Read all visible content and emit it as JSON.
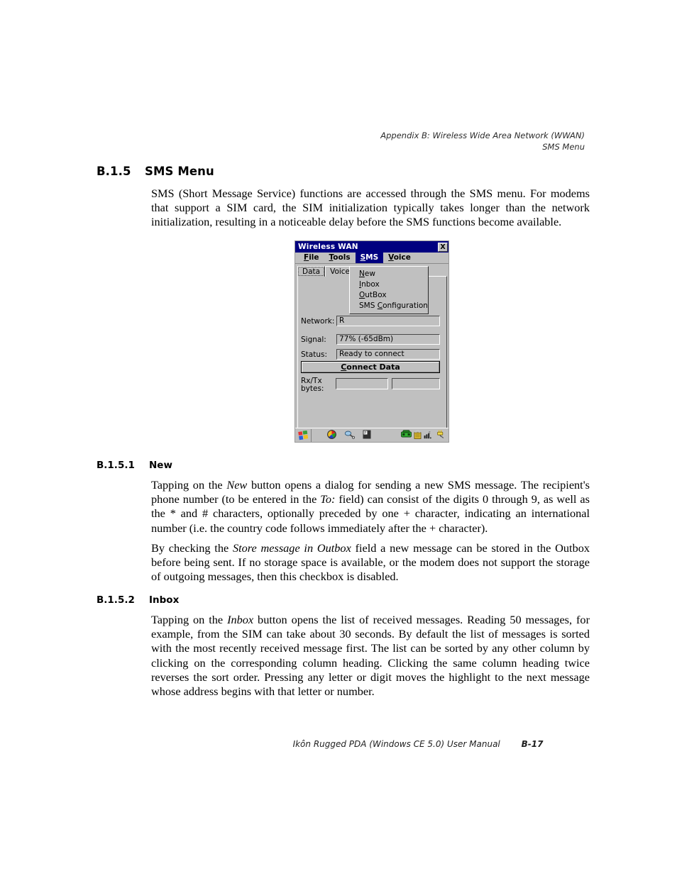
{
  "header": {
    "line1": "Appendix B: Wireless Wide Area Network (WWAN)",
    "line2": "SMS Menu"
  },
  "footer": {
    "manual": "Ikôn Rugged PDA (Windows CE 5.0) User Manual",
    "page": "B-17"
  },
  "sections": {
    "sms_menu": {
      "number": "B.1.5",
      "title": "SMS Menu",
      "body": "SMS (Short Message Service) functions are accessed through the SMS menu. For modems that support a SIM card, the SIM initialization typically takes longer than the network initialization, resulting in a noticeable delay before the SMS functions become available."
    },
    "new": {
      "number": "B.1.5.1",
      "title": "New",
      "para1_a": "Tapping on the ",
      "para1_em1": "New",
      "para1_b": " button opens a dialog for sending a new SMS message. The recipient's phone number (to be entered in the ",
      "para1_em2": "To:",
      "para1_c": " field) can consist of the digits 0 through 9, as well as the * and # characters, optionally preceded by one + character, indicating an international number (i.e. the country code follows immediately after the + character).",
      "para2_a": "By checking the ",
      "para2_em1": "Store message in Outbox",
      "para2_b": " field a new message can be stored in the Outbox before being sent. If no storage space is available, or the modem does not support the storage of outgoing messages, then this checkbox is disabled."
    },
    "inbox": {
      "number": "B.1.5.2",
      "title": "Inbox",
      "para1_a": "Tapping on the ",
      "para1_em1": "Inbox",
      "para1_b": " button opens the list of received messages. Reading 50 messages, for example, from the SIM can take about 30 seconds. By default the list of messages is sorted with the most recently received message first. The list can be sorted by any other column by clicking on the corresponding column heading. Clicking the same column heading twice reverses the sort order. Pressing any letter or digit moves the highlight to the next message whose address begins with that letter or number."
    }
  },
  "pda": {
    "window_title": "Wireless WAN",
    "close_label": "X",
    "menubar": [
      {
        "label": "File",
        "accel": "F",
        "rest": "ile",
        "active": false
      },
      {
        "label": "Tools",
        "accel": "T",
        "rest": "ools",
        "active": false
      },
      {
        "label": "SMS",
        "accel": "S",
        "rest": "MS",
        "active": true
      },
      {
        "label": "Voice",
        "accel": "V",
        "rest": "oice",
        "active": false
      }
    ],
    "tabs": [
      {
        "label": "Data",
        "selected": true
      },
      {
        "label": "Voice",
        "selected": false
      }
    ],
    "dropdown": {
      "open_menu": "SMS",
      "items": [
        {
          "accel": "N",
          "rest": "ew",
          "label": "New"
        },
        {
          "accel": "I",
          "rest": "nbox",
          "label": "Inbox"
        },
        {
          "accel": "O",
          "rest": "utBox",
          "label": "OutBox"
        },
        {
          "pre": "SMS ",
          "accel": "C",
          "rest": "onfiguration",
          "label": "SMS Configuration"
        }
      ]
    },
    "fields": [
      {
        "label": "Network:",
        "value": "R"
      },
      {
        "label": "Signal:",
        "value": "77% (-65dBm)"
      },
      {
        "label": "Status:",
        "value": "Ready to connect"
      }
    ],
    "connect_button": {
      "accel": "C",
      "rest": "onnect Data",
      "label": "Connect Data"
    },
    "rxtx": {
      "label_line1": "Rx/Tx",
      "label_line2": "bytes:",
      "value_rx": "",
      "value_tx": ""
    },
    "taskbar": {
      "start_icon": "windows-start-icon",
      "icons_mid": [
        "color-wheel-icon",
        "network-connection-icon",
        "keyboard-input-panel-icon"
      ],
      "icons_right": [
        "telephone-icon",
        "security-lock-icon",
        "signal-strength-icon",
        "power-plug-icon"
      ]
    },
    "colors": {
      "titlebar": "#000080",
      "face": "#c0c0c0",
      "highlight": "#ffffff",
      "shadow": "#4a4a4a"
    }
  }
}
